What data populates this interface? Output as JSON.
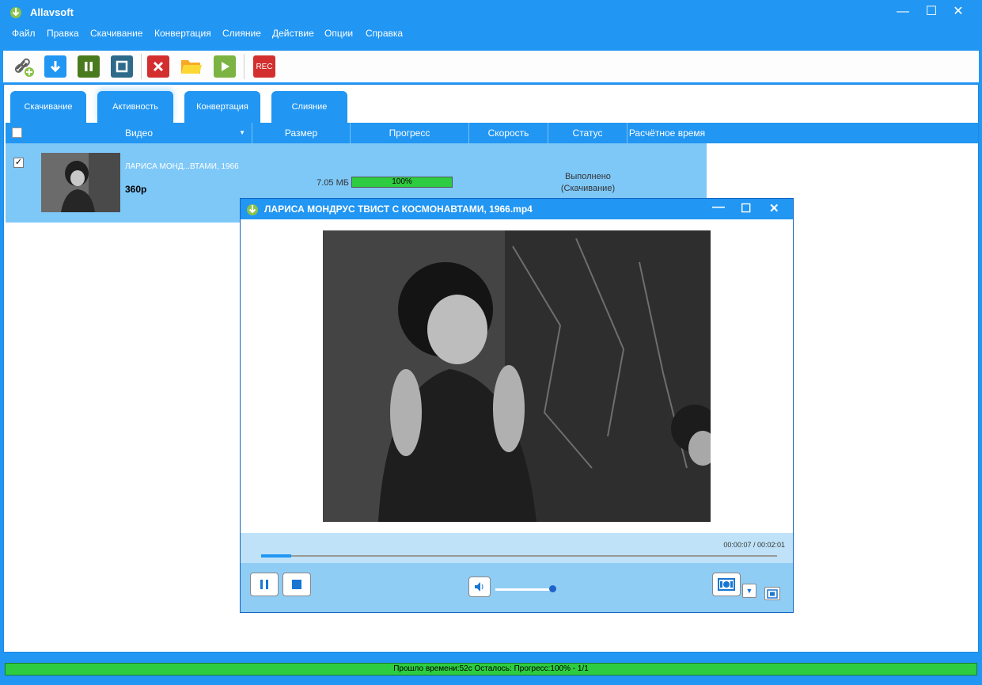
{
  "app": {
    "title": "Allavsoft"
  },
  "menu": [
    "Файл",
    "Правка",
    "Скачивание",
    "Конвертация",
    "Слияние",
    "Действие",
    "Опции",
    "Справка"
  ],
  "toolbar": {
    "rec_label": "REC"
  },
  "tabs": [
    "Скачивание",
    "Активность",
    "Конвертация",
    "Слияние"
  ],
  "columns": {
    "video": "Видео",
    "size": "Размер",
    "progress": "Прогресс",
    "speed": "Скорость",
    "status": "Статус",
    "eta": "Расчётное время"
  },
  "row": {
    "title": "ЛАРИСА МОНД...ВТАМИ, 1966",
    "quality": "360p",
    "size": "7.05 МБ",
    "progress_label": "100%",
    "progress_value": 1.0,
    "status_line1": "Выполнено",
    "status_line2": "(Скачивание)"
  },
  "player": {
    "title": "ЛАРИСА МОНДРУС ТВИСТ С КОСМОНАВТАМИ, 1966.mp4",
    "time": "00:00:07 / 00:02:01",
    "seek_fraction": 0.058,
    "volume_fraction": 1.0
  },
  "status_bar": "Прошло времени:52с Осталось: Прогресс:100% - 1/1",
  "colors": {
    "accent": "#2196f3",
    "row_bg": "#7ec8f8",
    "progress_green": "#2ecc40"
  }
}
